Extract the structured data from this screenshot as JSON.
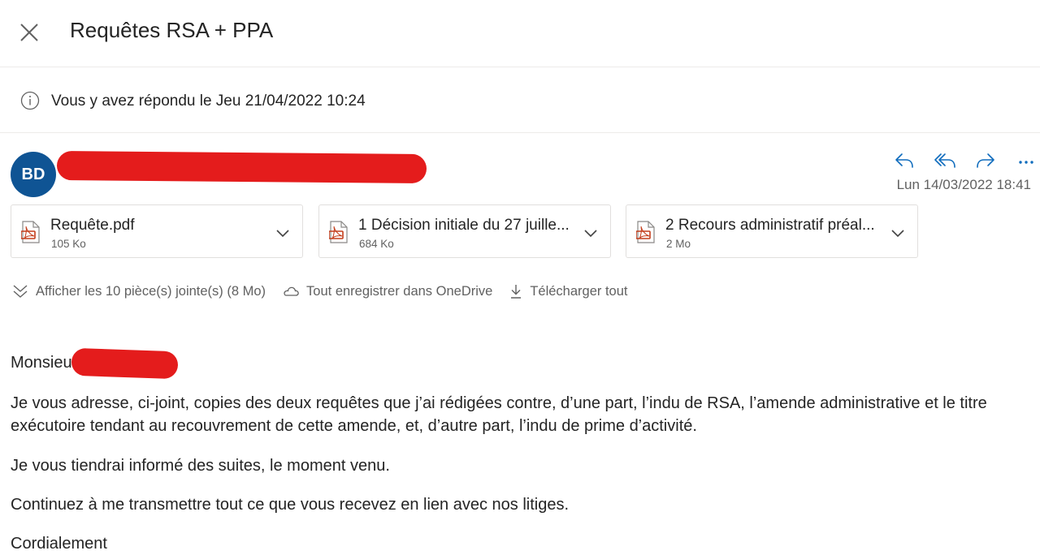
{
  "header": {
    "subject": "Requêtes RSA + PPA",
    "close_icon": "close-icon"
  },
  "info": {
    "text": "Vous y avez répondu le Jeu 21/04/2022 10:24"
  },
  "sender": {
    "initials": "BD",
    "avatar_color": "#0f5494"
  },
  "message": {
    "date": "Lun 14/03/2022 18:41"
  },
  "attachments": [
    {
      "name": "Requête.pdf",
      "size": "105 Ko"
    },
    {
      "name": "1 Décision initiale du 27 juille...",
      "size": "684 Ko"
    },
    {
      "name": "2 Recours administratif préal...",
      "size": "2 Mo"
    }
  ],
  "links": {
    "show_all": "Afficher les 10 pièce(s) jointe(s) (8 Mo)",
    "save_onedrive": "Tout enregistrer dans OneDrive",
    "download_all": "Télécharger tout"
  },
  "body": {
    "greeting": "Monsieu",
    "p1_line1": "Je vous adresse, ci-joint, copies des deux requêtes que j’ai rédigées contre, d’une part, l’indu de RSA, l’amende administrative et le titre",
    "p1_line2": "exécutoire tendant au recouvrement de cette amende, et, d’autre part, l’indu de prime d’activité.",
    "p2": "Je vous tiendrai informé des suites, le moment venu.",
    "p3": "Continuez à me transmettre tout ce que vous recevez en lien avec nos litiges.",
    "p4": "Cordialement"
  },
  "colors": {
    "accent": "#0f6cbd",
    "redaction": "#e41c1c",
    "pdf_red": "#c43e1c"
  }
}
